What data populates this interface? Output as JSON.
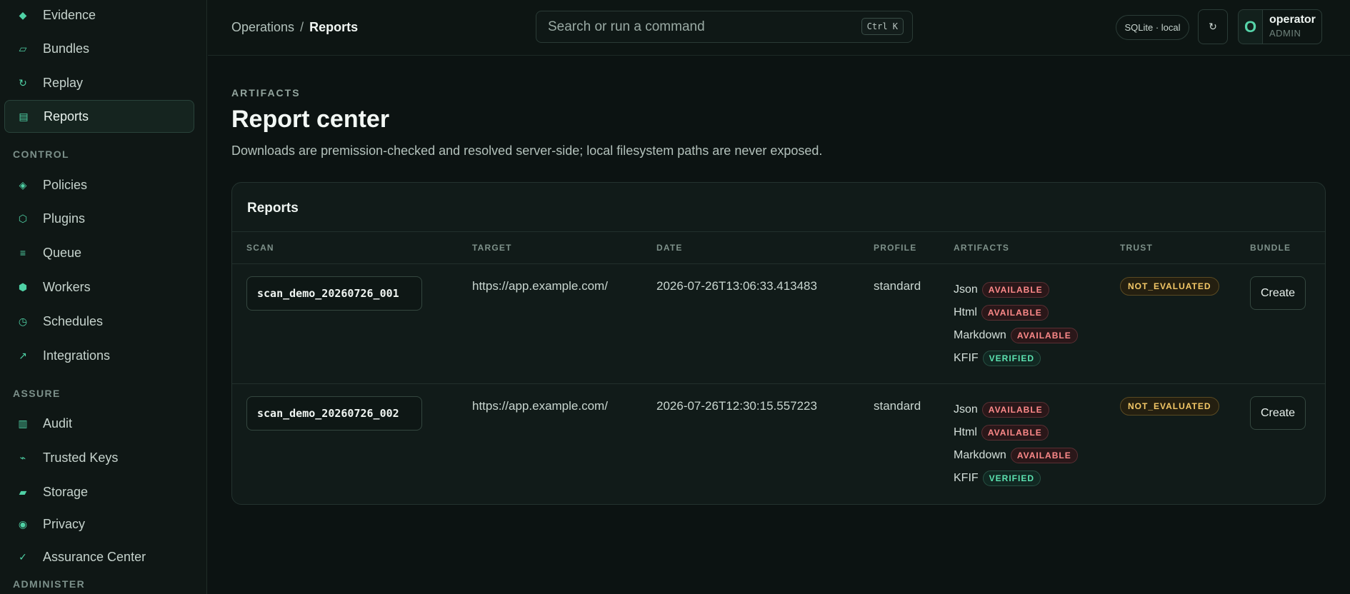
{
  "sidebar": {
    "items_top": [
      {
        "label": "Evidence",
        "icon": "◆"
      },
      {
        "label": "Bundles",
        "icon": "▱"
      },
      {
        "label": "Replay",
        "icon": "↻"
      },
      {
        "label": "Reports",
        "icon": "▤",
        "active": true
      }
    ],
    "section_control": "CONTROL",
    "items_control": [
      {
        "label": "Policies",
        "icon": "◈"
      },
      {
        "label": "Plugins",
        "icon": "⬡"
      },
      {
        "label": "Queue",
        "icon": "≡"
      },
      {
        "label": "Workers",
        "icon": "⬢"
      },
      {
        "label": "Schedules",
        "icon": "◷"
      },
      {
        "label": "Integrations",
        "icon": "↗"
      }
    ],
    "section_assure": "ASSURE",
    "items_assure": [
      {
        "label": "Audit",
        "icon": "▥"
      },
      {
        "label": "Trusted Keys",
        "icon": "⌁"
      },
      {
        "label": "Storage",
        "icon": "▰"
      },
      {
        "label": "Privacy",
        "icon": "◉"
      },
      {
        "label": "Assurance Center",
        "icon": "✓"
      }
    ],
    "section_administer": "ADMINISTER"
  },
  "header": {
    "breadcrumb_parent": "Operations",
    "breadcrumb_sep": "/",
    "breadcrumb_current": "Reports",
    "search_placeholder": "Search or run a command",
    "search_shortcut": "Ctrl K",
    "db_label": "SQLite · local",
    "refresh_icon": "↻",
    "avatar_initial": "O",
    "user_name": "operator",
    "user_role": "ADMIN"
  },
  "main": {
    "eyebrow": "ARTIFACTS",
    "title": "Report center",
    "subtitle": "Downloads are premission-checked and resolved server-side; local filesystem paths are never exposed.",
    "panel_title": "Reports",
    "columns": [
      "SCAN",
      "TARGET",
      "DATE",
      "PROFILE",
      "ARTIFACTS",
      "TRUST",
      "BUNDLE"
    ],
    "rows": [
      {
        "scan": "scan_demo_20260726_001",
        "target": "https://app.example.com/",
        "date": "2026-07-26T13:06:33.413483",
        "profile": "standard",
        "artifacts": [
          {
            "name": "Json",
            "status": "AVAILABLE"
          },
          {
            "name": "Html",
            "status": "AVAILABLE"
          },
          {
            "name": "Markdown",
            "status": "AVAILABLE"
          },
          {
            "name": "KFIF",
            "status": "VERIFIED"
          }
        ],
        "trust": "NOT_EVALUATED",
        "bundle_action": "Create"
      },
      {
        "scan": "scan_demo_20260726_002",
        "target": "https://app.example.com/",
        "date": "2026-07-26T12:30:15.557223",
        "profile": "standard",
        "artifacts": [
          {
            "name": "Json",
            "status": "AVAILABLE"
          },
          {
            "name": "Html",
            "status": "AVAILABLE"
          },
          {
            "name": "Markdown",
            "status": "AVAILABLE"
          },
          {
            "name": "KFIF",
            "status": "VERIFIED"
          }
        ],
        "trust": "NOT_EVALUATED",
        "bundle_action": "Create"
      }
    ]
  },
  "colors": {
    "accent": "#4fd1a5",
    "background": "#0c1312",
    "available": "#ff8a8a",
    "verified": "#5ce2b0",
    "trust_warning": "#f4c867"
  }
}
